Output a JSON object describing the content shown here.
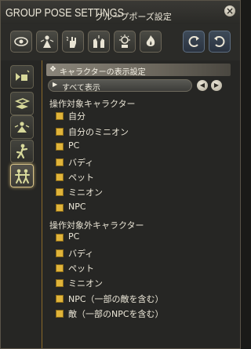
{
  "window": {
    "title": "GROUP POSE SETTINGS",
    "subtitle": "グループポーズ設定",
    "close_label": "×"
  },
  "toolbar": {
    "buttons": [
      {
        "name": "eye-icon",
        "icon": "eye-icon"
      },
      {
        "name": "person-light-icon",
        "icon": "person-light-icon"
      },
      {
        "name": "hand-wave-icon",
        "icon": "hand-wave-icon"
      },
      {
        "name": "hands-icon",
        "icon": "hands-icon"
      },
      {
        "name": "sun-gear-icon",
        "icon": "sun-gear-icon"
      },
      {
        "name": "fire-icon",
        "icon": "fire-icon"
      },
      {
        "name": "swap-left-icon",
        "icon": "swap-left-icon"
      },
      {
        "name": "swap-right-icon",
        "icon": "swap-right-icon"
      }
    ]
  },
  "sidebar": {
    "tabs": [
      {
        "name": "tab-camera-icon",
        "active": false
      },
      {
        "name": "tab-frame-icon",
        "active": false
      },
      {
        "name": "tab-light-icon",
        "active": false
      },
      {
        "name": "tab-pose-icon",
        "active": false
      },
      {
        "name": "tab-characters-icon",
        "active": true
      }
    ]
  },
  "main": {
    "section_title": "キャラクターの表示設定",
    "dropdown_value": "すべて表示",
    "groups": [
      {
        "label": "操作対象キャラクター",
        "items": [
          "自分",
          "自分のミニオン",
          "PC",
          "バディ",
          "ペット",
          "ミニオン",
          "NPC"
        ]
      },
      {
        "label": "操作対象外キャラクター",
        "items": [
          "PC",
          "バディ",
          "ペット",
          "ミニオン",
          "NPC（一部の敵を含む）",
          "敵（一部のNPCを含む）"
        ]
      }
    ]
  },
  "colors": {
    "checkbox": "#e0b43a",
    "accent_divider": "#8a6a2a",
    "text": "#ece7d8"
  }
}
